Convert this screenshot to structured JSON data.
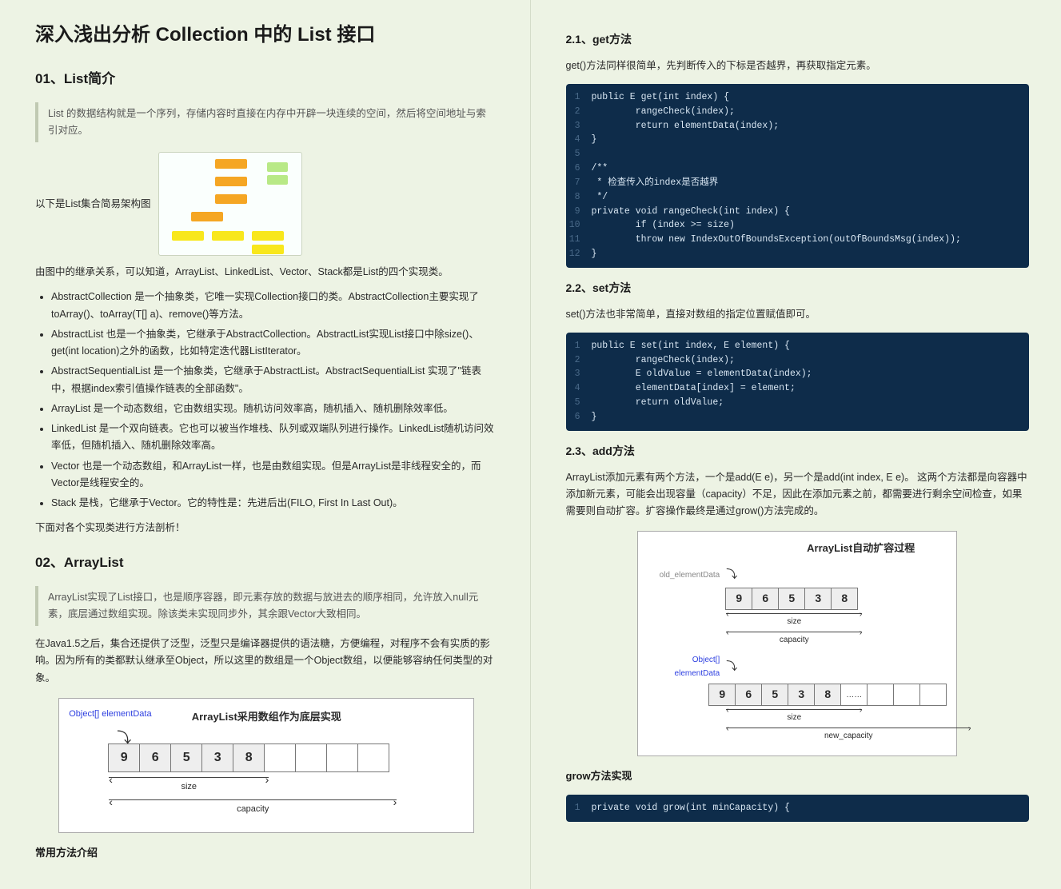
{
  "title": "深入浅出分析 Collection 中的 List 接口",
  "left": {
    "h_01": "01、List简介",
    "quote_01": "List 的数据结构就是一个序列，存储内容时直接在内存中开辟一块连续的空间，然后将空间地址与索引对应。",
    "diagram_label": "以下是List集合简易架构图",
    "p_inheritance": "由图中的继承关系，可以知道，ArrayList、LinkedList、Vector、Stack都是List的四个实现类。",
    "bullets": [
      "AbstractCollection 是一个抽象类，它唯一实现Collection接口的类。AbstractCollection主要实现了toArray()、toArray(T[] a)、remove()等方法。",
      "AbstractList 也是一个抽象类，它继承于AbstractCollection。AbstractList实现List接口中除size()、get(int location)之外的函数，比如特定迭代器ListIterator。",
      "AbstractSequentialList 是一个抽象类，它继承于AbstractList。AbstractSequentialList 实现了\"链表中，根据index索引值操作链表的全部函数\"。",
      "ArrayList 是一个动态数组，它由数组实现。随机访问效率高，随机插入、随机删除效率低。",
      "LinkedList 是一个双向链表。它也可以被当作堆栈、队列或双端队列进行操作。LinkedList随机访问效率低，但随机插入、随机删除效率高。",
      "Vector 也是一个动态数组，和ArrayList一样，也是由数组实现。但是ArrayList是非线程安全的，而Vector是线程安全的。",
      "Stack 是栈，它继承于Vector。它的特性是：先进后出(FILO, First In Last Out)。"
    ],
    "p_analyze": "下面对各个实现类进行方法剖析！",
    "h_02": "02、ArrayList",
    "quote_02": "ArrayList实现了List接口，也是顺序容器，即元素存放的数据与放进去的顺序相同，允许放入null元素，底层通过数组实现。除该类未实现同步外，其余跟Vector大致相同。",
    "p_generics": "在Java1.5之后，集合还提供了泛型，泛型只是编译器提供的语法糖，方便编程，对程序不会有实质的影响。因为所有的类都默认继承至Object，所以这里的数组是一个Object数组，以便能够容纳任何类型的对象。",
    "al_diagram": {
      "object_label": "Object[] elementData",
      "title": "ArrayList采用数组作为底层实现",
      "cells": [
        "9",
        "6",
        "5",
        "3",
        "8",
        "",
        "",
        "",
        ""
      ],
      "size_label": "size",
      "capacity_label": "capacity"
    },
    "h_methods": "常用方法介绍"
  },
  "right": {
    "h_21": "2.1、get方法",
    "p_21": "get()方法同样很简单，先判断传入的下标是否越界，再获取指定元素。",
    "code_get": [
      "public E get(int index) {",
      "        rangeCheck(index);",
      "        return elementData(index);",
      "}",
      "",
      "/**",
      " * 检查传入的index是否越界",
      " */",
      "private void rangeCheck(int index) {",
      "        if (index >= size)",
      "        throw new IndexOutOfBoundsException(outOfBoundsMsg(index));",
      "}"
    ],
    "h_22": "2.2、set方法",
    "p_22": "set()方法也非常简单，直接对数组的指定位置赋值即可。",
    "code_set": [
      "public E set(int index, E element) {",
      "        rangeCheck(index);",
      "        E oldValue = elementData(index);",
      "        elementData[index] = element;",
      "        return oldValue;",
      "}"
    ],
    "h_23": "2.3、add方法",
    "p_23": "ArrayList添加元素有两个方法，一个是add(E e)，另一个是add(int index, E e)。 这两个方法都是向容器中添加新元素，可能会出现容量（capacity）不足，因此在添加元素之前，都需要进行剩余空间检查，如果需要则自动扩容。扩容操作最终是通过grow()方法完成的。",
    "expand_diagram": {
      "title": "ArrayList自动扩容过程",
      "old_label": "old_elementData",
      "new_label": "Object[] elementData",
      "cells_top": [
        "9",
        "6",
        "5",
        "3",
        "8"
      ],
      "cells_bottom": [
        "9",
        "6",
        "5",
        "3",
        "8",
        "……",
        "",
        "",
        ""
      ],
      "size_label": "size",
      "capacity_label": "capacity",
      "new_capacity_label": "new_capacity"
    },
    "h_grow": "grow方法实现",
    "code_grow": [
      "private void grow(int minCapacity) {"
    ]
  }
}
